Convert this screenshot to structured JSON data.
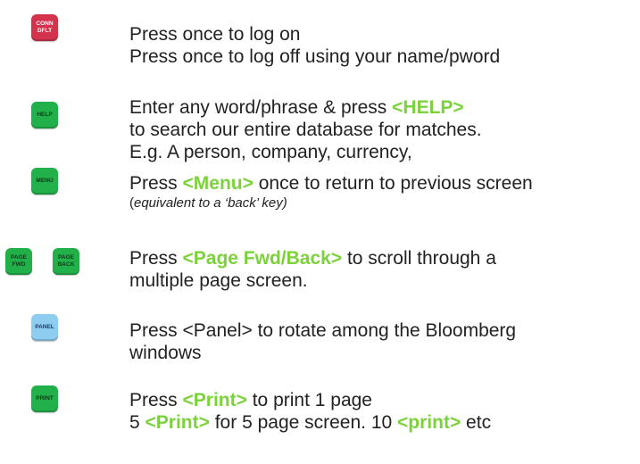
{
  "colors": {
    "key_red": "#d3334d",
    "key_green": "#22b04b",
    "key_blue": "#8ecdf0",
    "highlight": "#7cd23b",
    "text": "#222222"
  },
  "items": [
    {
      "keys": [
        {
          "icon": "conn-dflt-key",
          "label_1": "CONN",
          "label_2": "DFLT"
        }
      ],
      "lines": [
        "Press once to log on",
        "Press once to log off using your name/pword"
      ]
    },
    {
      "keys": [
        {
          "icon": "help-key",
          "label_1": "HELP"
        }
      ],
      "line1_pre": "Enter any word/phrase & press ",
      "line1_key": "<HELP>",
      "line2": "to search our entire database for matches.",
      "line3": "E.g.  A person, company, currency,"
    },
    {
      "keys": [
        {
          "icon": "menu-key",
          "label_1": "MENU"
        }
      ],
      "line1_pre": "Press ",
      "line1_key": "<Menu>",
      "line1_post": " once to return to previous screen",
      "line2_open": "(",
      "line2_italic": "equivalent to a ‘back’ key)"
    },
    {
      "keys": [
        {
          "icon": "page-fwd-key",
          "label_1": "PAGE",
          "label_2": "FWD"
        },
        {
          "icon": "page-back-key",
          "label_1": "PAGE",
          "label_2": "BACK"
        }
      ],
      "line1_pre": "Press ",
      "line1_key": "<Page Fwd/Back>",
      "line1_post": " to scroll through a",
      "line2": "multiple page screen."
    },
    {
      "keys": [
        {
          "icon": "panel-key",
          "label_1": "PANEL"
        }
      ],
      "line1": "Press <Panel> to rotate among the Bloomberg",
      "line2": "windows"
    },
    {
      "keys": [
        {
          "icon": "print-key",
          "label_1": "PRINT"
        }
      ],
      "line1_pre": "Press ",
      "line1_key": "<Print>",
      "line1_post": " to print 1 page",
      "line2_a": "5 ",
      "line2_key_a": "<Print>",
      "line2_b": " for 5 page screen.  10 ",
      "line2_key_b": "<print>",
      "line2_c": " etc"
    }
  ]
}
